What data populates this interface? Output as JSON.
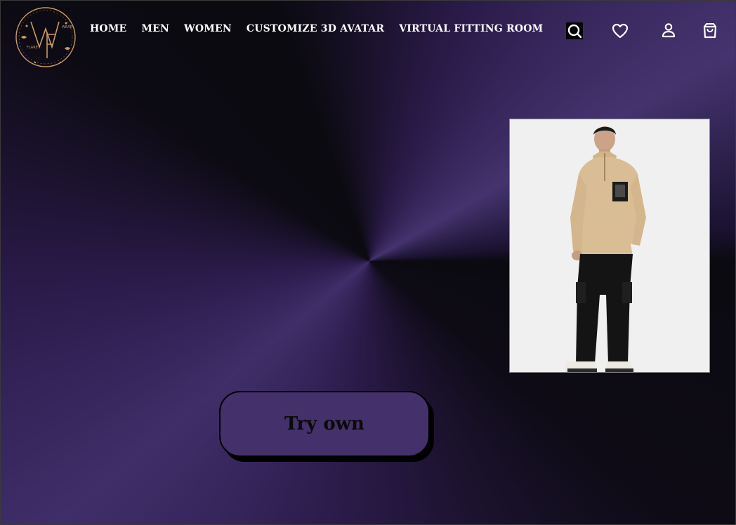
{
  "brand": {
    "logo_letters": "WF",
    "logo_words": [
      "WEAR",
      "FLARE"
    ],
    "logo_color": "#c89a63"
  },
  "nav": {
    "items": [
      {
        "label": "HOME"
      },
      {
        "label": "MEN"
      },
      {
        "label": "WOMEN"
      },
      {
        "label": "CUSTOMIZE 3D AVATAR"
      },
      {
        "label": "VIRTUAL FITTING ROOM"
      }
    ]
  },
  "header_icons": [
    "search-icon",
    "heart-icon",
    "user-icon",
    "shopping-bag-icon"
  ],
  "product": {
    "image": "product-photo"
  },
  "cta": {
    "label": "Try own",
    "color": "#44306a"
  },
  "colors": {
    "accent": "#44306a",
    "background_dark": "#0b0a10",
    "text": "#ffffff"
  }
}
